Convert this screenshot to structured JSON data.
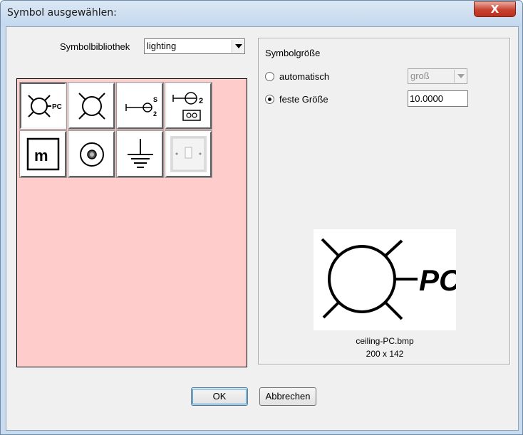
{
  "window": {
    "title": "Symbol ausgewählen:",
    "close_glyph": "X"
  },
  "library": {
    "label": "Symbolbibliothek",
    "selected": "lighting"
  },
  "tiles": [
    {
      "icon": "ceiling-pc-symbol-icon"
    },
    {
      "icon": "ceiling-light-icon"
    },
    {
      "icon": "wall-light-s2-icon"
    },
    {
      "icon": "wall-light-socket-icon"
    },
    {
      "icon": "m-box-icon"
    },
    {
      "icon": "target-circle-icon"
    },
    {
      "icon": "ground-icon"
    },
    {
      "icon": "light-switch-photo-icon"
    }
  ],
  "size_group": {
    "title": "Symbolgröße",
    "auto_label": "automatisch",
    "auto_selected": false,
    "auto_size_value": "groß",
    "fixed_label": "feste Größe",
    "fixed_selected": true,
    "fixed_value": "10.0000"
  },
  "preview": {
    "filename": "ceiling-PC.bmp",
    "dimensions": "200 x 142"
  },
  "buttons": {
    "ok": "OK",
    "cancel": "Abbrechen"
  }
}
